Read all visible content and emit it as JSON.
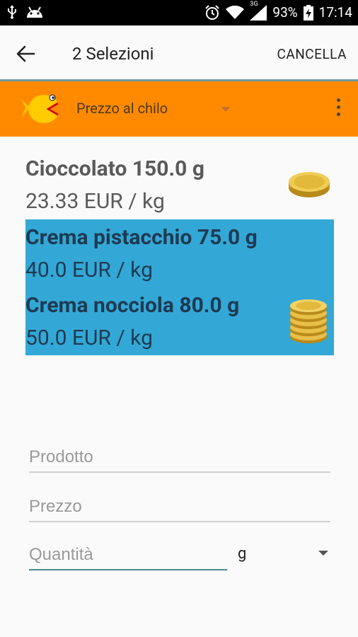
{
  "status_bar": {
    "battery_percent": "93%",
    "time": "17:14",
    "network": "3G",
    "icons": [
      "usb-icon",
      "android-icon",
      "alarm-icon",
      "wifi-icon",
      "signal-icon",
      "battery-charging-icon"
    ]
  },
  "action_bar": {
    "title": "2 Selezioni",
    "cancel_label": "CANCELLA",
    "back_icon": "arrow-left-icon"
  },
  "toolbar": {
    "spinner_label": "Prezzo al chilo",
    "background": "#ff8a00",
    "logo_icon": "fish-logo-icon",
    "overflow_icon": "more-vert-icon"
  },
  "products": [
    {
      "name": "Cioccolato 150.0 g",
      "price": "23.33 EUR / kg",
      "selected": false,
      "badge": "single-coin-icon"
    },
    {
      "name": "Crema pistacchio 75.0 g",
      "price": "40.0 EUR / kg",
      "selected": true,
      "badge": ""
    },
    {
      "name": "Crema nocciola 80.0 g",
      "price": "50.0 EUR / kg",
      "selected": true,
      "badge": "coin-stack-icon"
    }
  ],
  "form": {
    "product_placeholder": "Prodotto",
    "price_placeholder": "Prezzo",
    "quantity_placeholder": "Quantità",
    "unit": "g"
  },
  "colors": {
    "accent": "#ff8a00",
    "selected": "#33a8d6",
    "focus_line": "#4a8a8e"
  }
}
